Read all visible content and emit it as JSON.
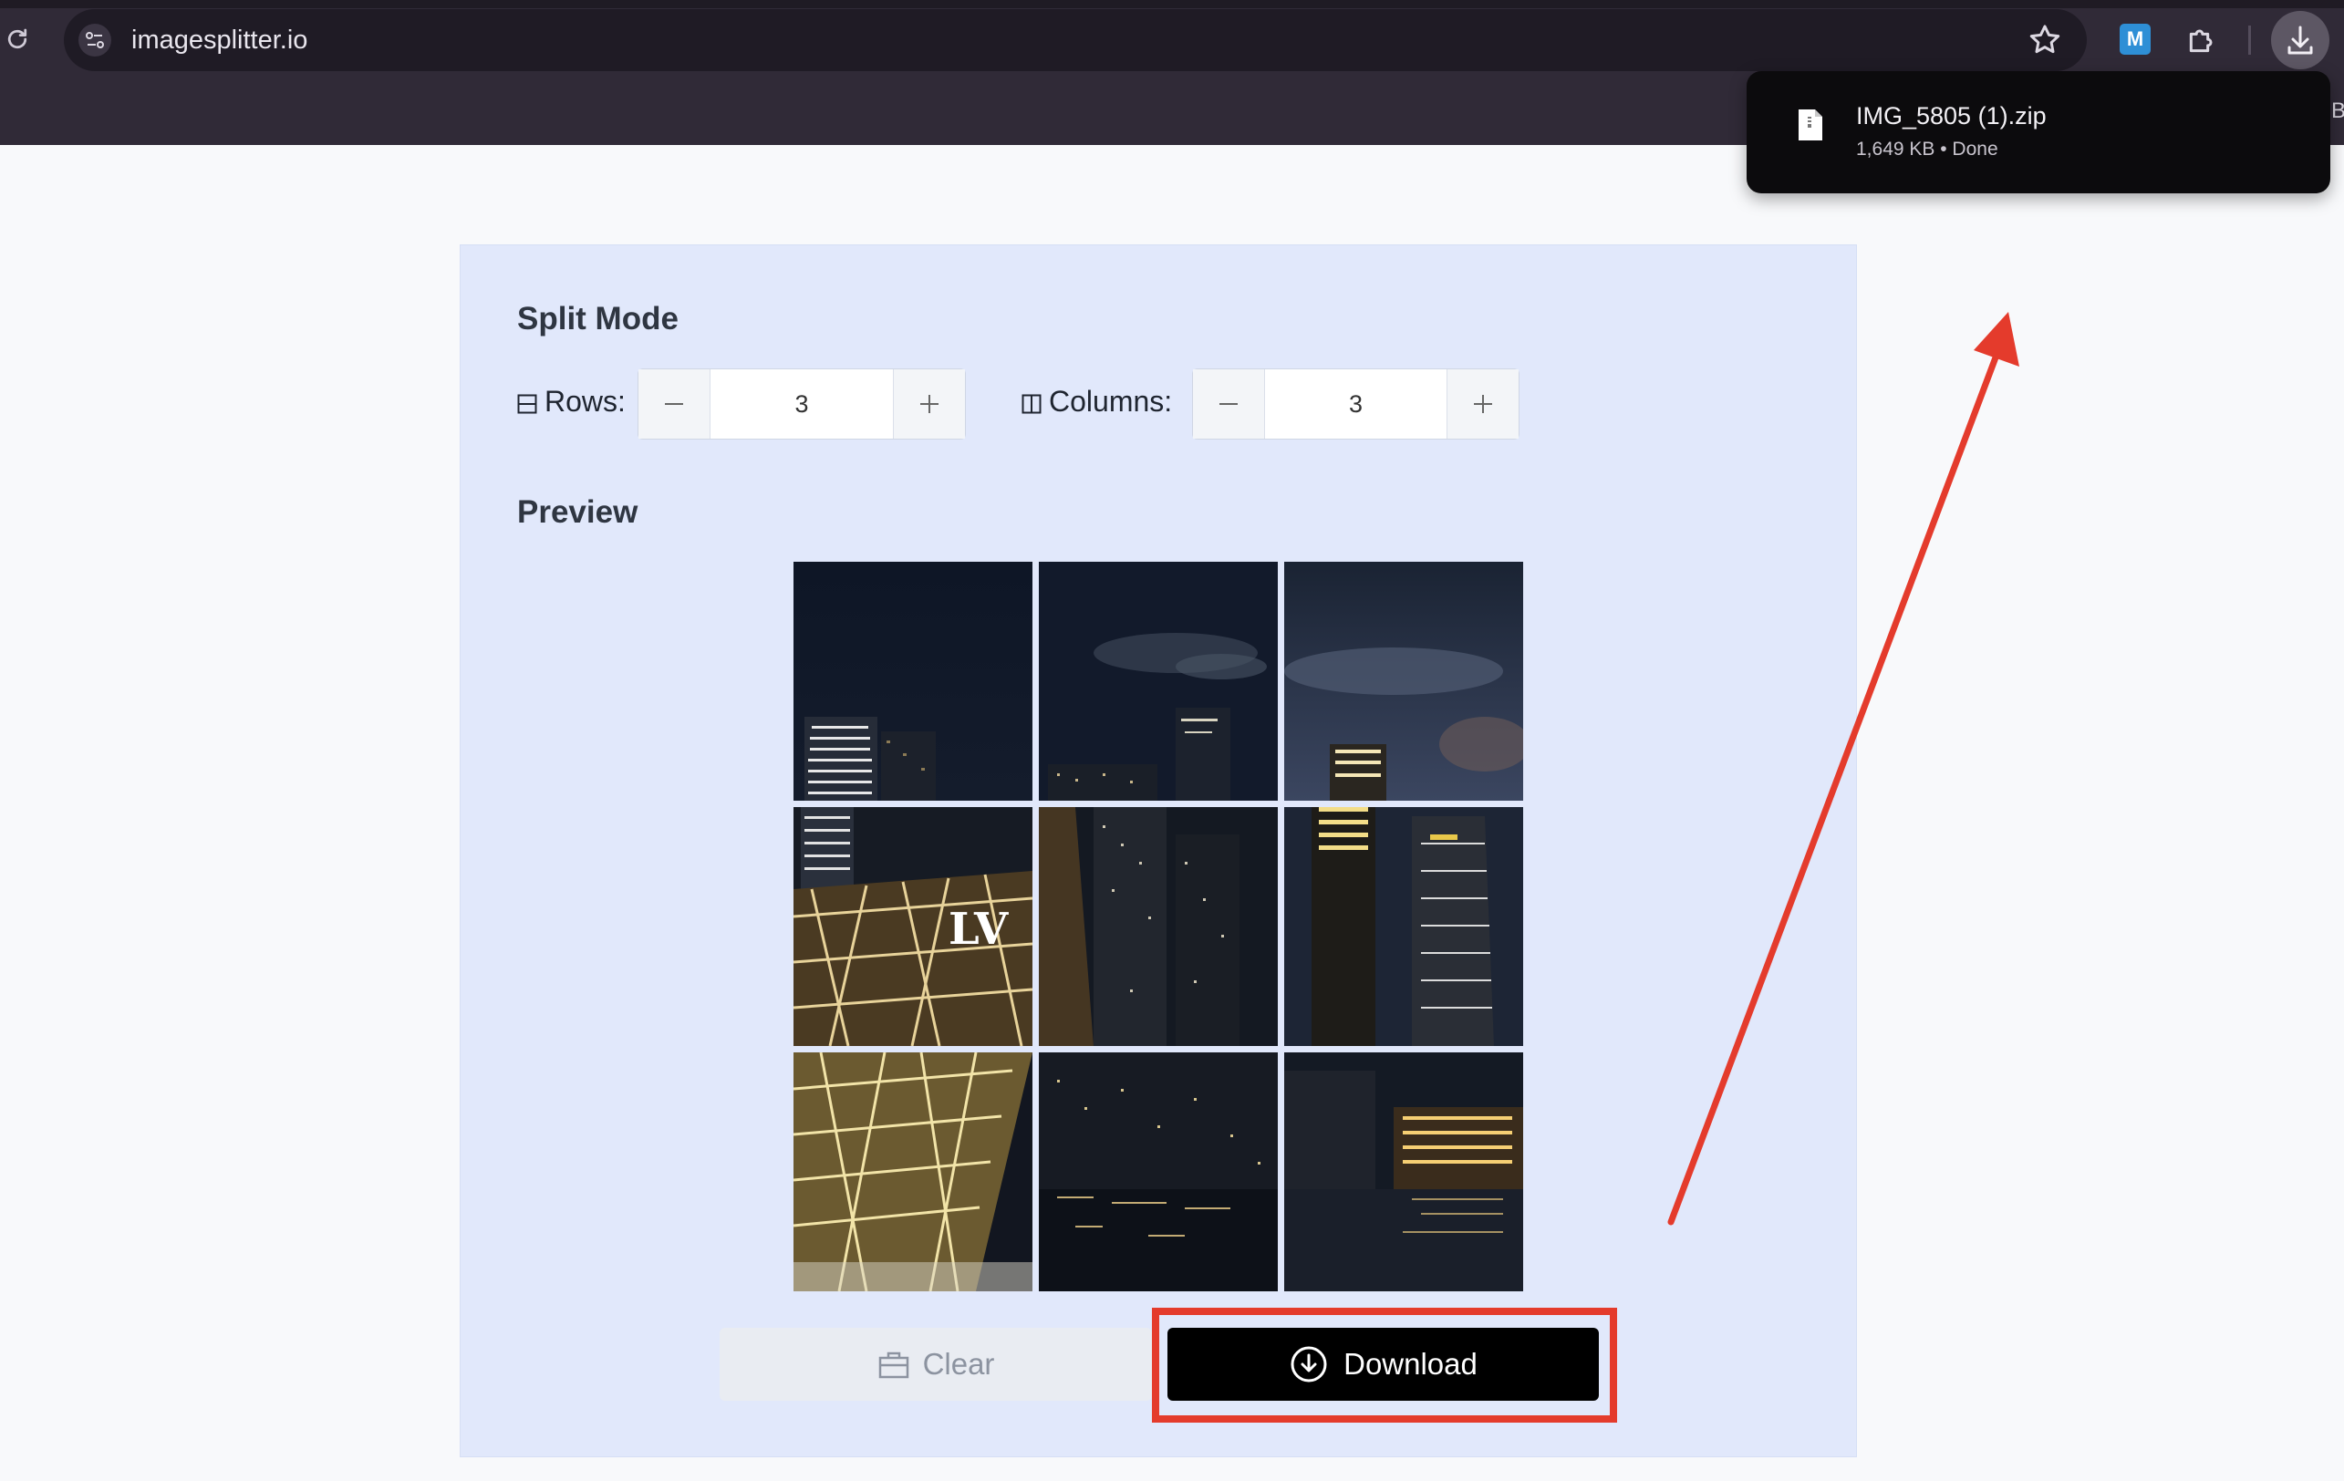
{
  "browser": {
    "url": "imagesplitter.io",
    "edge_text": "B",
    "icons": [
      "reload-icon",
      "site-settings-icon",
      "bookmark-star-icon",
      "extension-m-icon",
      "extensions-puzzle-icon",
      "downloads-icon"
    ],
    "extension_letter": "M"
  },
  "download_popup": {
    "filename": "IMG_5805 (1).zip",
    "meta": "1,649 KB • Done"
  },
  "page": {
    "split_mode_title": "Split Mode",
    "rows_label": "Rows:",
    "rows_value": "3",
    "columns_label": "Columns:",
    "columns_value": "3",
    "preview_title": "Preview",
    "grid_rows": 3,
    "grid_columns": 3,
    "clear_label": "Clear",
    "download_label": "Download"
  },
  "colors": {
    "card_bg": "#e1e8fb",
    "highlight": "#e43b2c",
    "download_bg": "#000000",
    "chrome_bg": "#302a37"
  }
}
